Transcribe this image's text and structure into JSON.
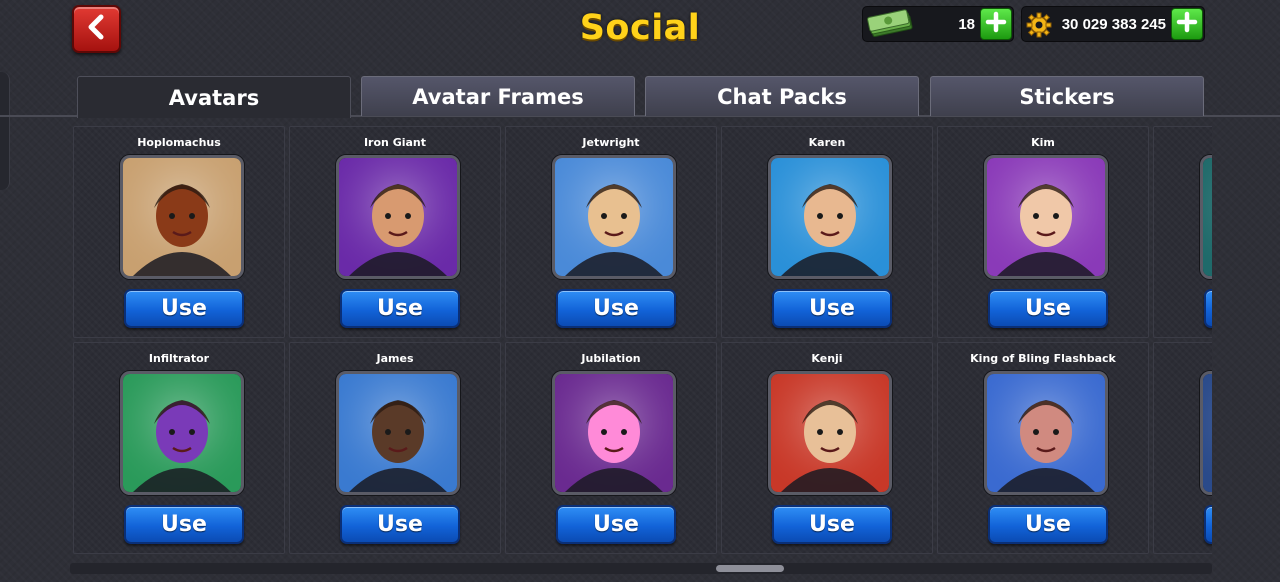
{
  "header": {
    "title": "Social",
    "back_icon": "chevron-left-icon",
    "cash": {
      "value": "18",
      "icon": "cash-stack-icon"
    },
    "coins": {
      "value": "30 029 383 245",
      "icon": "gold-gear-coin-icon"
    },
    "plus_icon": "plus-icon"
  },
  "tabs": [
    {
      "label": "Avatars",
      "active": true
    },
    {
      "label": "Avatar Frames",
      "active": false
    },
    {
      "label": "Chat Packs",
      "active": false
    },
    {
      "label": "Stickers",
      "active": false
    }
  ],
  "avatars": [
    {
      "name": "Hoplomachus",
      "button": "Use",
      "colors": {
        "bg": "#c8a070",
        "accent": "#8a3a18"
      }
    },
    {
      "name": "Iron Giant",
      "button": "Use",
      "colors": {
        "bg": "#6a2aa8",
        "accent": "#d89a70"
      }
    },
    {
      "name": "Jetwright",
      "button": "Use",
      "colors": {
        "bg": "#4a8ad8",
        "accent": "#e8c090"
      }
    },
    {
      "name": "Karen",
      "button": "Use",
      "colors": {
        "bg": "#2a90d8",
        "accent": "#e8b890"
      }
    },
    {
      "name": "Kim",
      "button": "Use",
      "colors": {
        "bg": "#8a3ab8",
        "accent": "#f0c8a8"
      }
    },
    {
      "name": "",
      "button": "Use",
      "colors": {
        "bg": "#1f6a6a",
        "accent": "#d0e0e0"
      }
    },
    {
      "name": "Infiltrator",
      "button": "Use",
      "colors": {
        "bg": "#2a9a5a",
        "accent": "#7a3ab8"
      }
    },
    {
      "name": "James",
      "button": "Use",
      "colors": {
        "bg": "#3a7ad0",
        "accent": "#5a3a28"
      }
    },
    {
      "name": "Jubilation",
      "button": "Use",
      "colors": {
        "bg": "#6a2a90",
        "accent": "#ff8ad8"
      }
    },
    {
      "name": "Kenji",
      "button": "Use",
      "colors": {
        "bg": "#c83828",
        "accent": "#e8c098"
      }
    },
    {
      "name": "King of Bling Flashback",
      "button": "Use",
      "colors": {
        "bg": "#3a6ad0",
        "accent": "#d08a80"
      }
    },
    {
      "name": "",
      "button": "Use",
      "colors": {
        "bg": "#2a4a8a",
        "accent": "#c0c8d8"
      }
    }
  ]
}
